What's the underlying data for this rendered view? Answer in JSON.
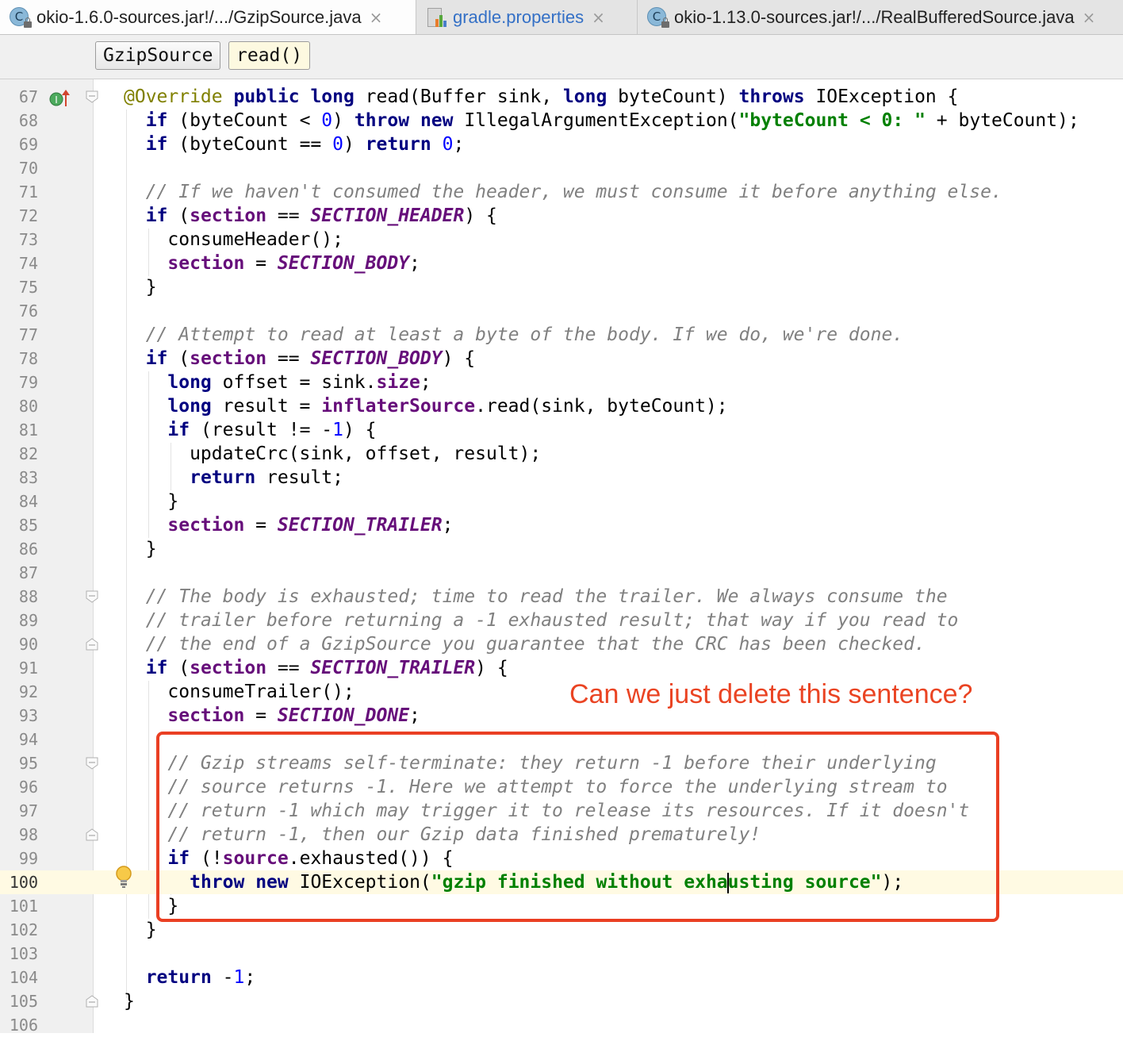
{
  "tabs": [
    {
      "label": "okio-1.6.0-sources.jar!/.../GzipSource.java",
      "icon": "class-icon",
      "icon_glyph": "C",
      "active": true
    },
    {
      "label": "gradle.properties",
      "icon": "gradle-properties-icon",
      "active": false
    },
    {
      "label": "okio-1.13.0-sources.jar!/.../RealBufferedSource.java",
      "icon": "class-icon",
      "icon_glyph": "C",
      "active": false
    }
  ],
  "tab_close_glyph": "×",
  "breadcrumbs": [
    "GzipSource",
    "read()"
  ],
  "editor": {
    "current_line": 100,
    "lines": [
      {
        "n": "67",
        "tokens": [
          [
            "a",
            "@Override"
          ],
          [
            "p",
            " "
          ],
          [
            "k",
            "public"
          ],
          [
            "p",
            " "
          ],
          [
            "k",
            "long"
          ],
          [
            "p",
            " read(Buffer sink, "
          ],
          [
            "k",
            "long"
          ],
          [
            "p",
            " byteCount) "
          ],
          [
            "k",
            "throws"
          ],
          [
            "p",
            " IOException {"
          ]
        ]
      },
      {
        "n": "68",
        "tokens": [
          [
            "p",
            "  "
          ],
          [
            "k",
            "if"
          ],
          [
            "p",
            " (byteCount < "
          ],
          [
            "n",
            "0"
          ],
          [
            "p",
            ") "
          ],
          [
            "k",
            "throw"
          ],
          [
            "p",
            " "
          ],
          [
            "k",
            "new"
          ],
          [
            "p",
            " IllegalArgumentException("
          ],
          [
            "s",
            "\"byteCount < 0: \""
          ],
          [
            "p",
            " + byteCount);"
          ]
        ]
      },
      {
        "n": "69",
        "tokens": [
          [
            "p",
            "  "
          ],
          [
            "k",
            "if"
          ],
          [
            "p",
            " (byteCount == "
          ],
          [
            "n",
            "0"
          ],
          [
            "p",
            ") "
          ],
          [
            "k",
            "return"
          ],
          [
            "p",
            " "
          ],
          [
            "n",
            "0"
          ],
          [
            "p",
            ";"
          ]
        ]
      },
      {
        "n": "70",
        "tokens": []
      },
      {
        "n": "71",
        "tokens": [
          [
            "p",
            "  "
          ],
          [
            "c",
            "// If we haven't consumed the header, we must consume it before anything else."
          ]
        ]
      },
      {
        "n": "72",
        "tokens": [
          [
            "p",
            "  "
          ],
          [
            "k",
            "if"
          ],
          [
            "p",
            " ("
          ],
          [
            "f",
            "section"
          ],
          [
            "p",
            " == "
          ],
          [
            "cst",
            "SECTION_HEADER"
          ],
          [
            "p",
            ") {"
          ]
        ]
      },
      {
        "n": "73",
        "tokens": [
          [
            "p",
            "    consumeHeader();"
          ]
        ]
      },
      {
        "n": "74",
        "tokens": [
          [
            "p",
            "    "
          ],
          [
            "f",
            "section"
          ],
          [
            "p",
            " = "
          ],
          [
            "cst",
            "SECTION_BODY"
          ],
          [
            "p",
            ";"
          ]
        ]
      },
      {
        "n": "75",
        "tokens": [
          [
            "p",
            "  }"
          ]
        ]
      },
      {
        "n": "76",
        "tokens": []
      },
      {
        "n": "77",
        "tokens": [
          [
            "p",
            "  "
          ],
          [
            "c",
            "// Attempt to read at least a byte of the body. If we do, we're done."
          ]
        ]
      },
      {
        "n": "78",
        "tokens": [
          [
            "p",
            "  "
          ],
          [
            "k",
            "if"
          ],
          [
            "p",
            " ("
          ],
          [
            "f",
            "section"
          ],
          [
            "p",
            " == "
          ],
          [
            "cst",
            "SECTION_BODY"
          ],
          [
            "p",
            ") {"
          ]
        ]
      },
      {
        "n": "79",
        "tokens": [
          [
            "p",
            "    "
          ],
          [
            "k",
            "long"
          ],
          [
            "p",
            " offset = sink."
          ],
          [
            "f",
            "size"
          ],
          [
            "p",
            ";"
          ]
        ]
      },
      {
        "n": "80",
        "tokens": [
          [
            "p",
            "    "
          ],
          [
            "k",
            "long"
          ],
          [
            "p",
            " result = "
          ],
          [
            "f",
            "inflaterSource"
          ],
          [
            "p",
            ".read(sink, byteCount);"
          ]
        ]
      },
      {
        "n": "81",
        "tokens": [
          [
            "p",
            "    "
          ],
          [
            "k",
            "if"
          ],
          [
            "p",
            " (result != -"
          ],
          [
            "n",
            "1"
          ],
          [
            "p",
            ") {"
          ]
        ]
      },
      {
        "n": "82",
        "tokens": [
          [
            "p",
            "      updateCrc(sink, offset, result);"
          ]
        ]
      },
      {
        "n": "83",
        "tokens": [
          [
            "p",
            "      "
          ],
          [
            "k",
            "return"
          ],
          [
            "p",
            " result;"
          ]
        ]
      },
      {
        "n": "84",
        "tokens": [
          [
            "p",
            "    }"
          ]
        ]
      },
      {
        "n": "85",
        "tokens": [
          [
            "p",
            "    "
          ],
          [
            "f",
            "section"
          ],
          [
            "p",
            " = "
          ],
          [
            "cst",
            "SECTION_TRAILER"
          ],
          [
            "p",
            ";"
          ]
        ]
      },
      {
        "n": "86",
        "tokens": [
          [
            "p",
            "  }"
          ]
        ]
      },
      {
        "n": "87",
        "tokens": []
      },
      {
        "n": "88",
        "tokens": [
          [
            "p",
            "  "
          ],
          [
            "c",
            "// The body is exhausted; time to read the trailer. We always consume the"
          ]
        ]
      },
      {
        "n": "89",
        "tokens": [
          [
            "p",
            "  "
          ],
          [
            "c",
            "// trailer before returning a -1 exhausted result; that way if you read to"
          ]
        ]
      },
      {
        "n": "90",
        "tokens": [
          [
            "p",
            "  "
          ],
          [
            "c",
            "// the end of a GzipSource you guarantee that the CRC has been checked."
          ]
        ]
      },
      {
        "n": "91",
        "tokens": [
          [
            "p",
            "  "
          ],
          [
            "k",
            "if"
          ],
          [
            "p",
            " ("
          ],
          [
            "f",
            "section"
          ],
          [
            "p",
            " == "
          ],
          [
            "cst",
            "SECTION_TRAILER"
          ],
          [
            "p",
            ") {"
          ]
        ]
      },
      {
        "n": "92",
        "tokens": [
          [
            "p",
            "    consumeTrailer();"
          ]
        ]
      },
      {
        "n": "93",
        "tokens": [
          [
            "p",
            "    "
          ],
          [
            "f",
            "section"
          ],
          [
            "p",
            " = "
          ],
          [
            "cst",
            "SECTION_DONE"
          ],
          [
            "p",
            ";"
          ]
        ]
      },
      {
        "n": "94",
        "tokens": []
      },
      {
        "n": "95",
        "tokens": [
          [
            "p",
            "    "
          ],
          [
            "c",
            "// Gzip streams self-terminate: they return -1 before their underlying"
          ]
        ]
      },
      {
        "n": "96",
        "tokens": [
          [
            "p",
            "    "
          ],
          [
            "c",
            "// source returns -1. Here we attempt to force the underlying stream to"
          ]
        ]
      },
      {
        "n": "97",
        "tokens": [
          [
            "p",
            "    "
          ],
          [
            "c",
            "// return -1 which may trigger it to release its resources. If it doesn't"
          ]
        ]
      },
      {
        "n": "98",
        "tokens": [
          [
            "p",
            "    "
          ],
          [
            "c",
            "// return -1, then our Gzip data finished prematurely!"
          ]
        ]
      },
      {
        "n": "99",
        "tokens": [
          [
            "p",
            "    "
          ],
          [
            "k",
            "if"
          ],
          [
            "p",
            " (!"
          ],
          [
            "f",
            "source"
          ],
          [
            "p",
            ".exhausted()) {"
          ]
        ]
      },
      {
        "n": "100",
        "tokens": [
          [
            "p",
            "      "
          ],
          [
            "k",
            "throw"
          ],
          [
            "p",
            " "
          ],
          [
            "k",
            "new"
          ],
          [
            "p",
            " IOException("
          ],
          [
            "s",
            "\"gzip finished without exha"
          ],
          [
            "caret",
            ""
          ],
          [
            "s",
            "usting source\""
          ],
          [
            "p",
            ");"
          ]
        ]
      },
      {
        "n": "101",
        "tokens": [
          [
            "p",
            "    }"
          ]
        ]
      },
      {
        "n": "102",
        "tokens": [
          [
            "p",
            "  }"
          ]
        ]
      },
      {
        "n": "103",
        "tokens": []
      },
      {
        "n": "104",
        "tokens": [
          [
            "p",
            "  "
          ],
          [
            "k",
            "return"
          ],
          [
            "p",
            " -"
          ],
          [
            "n",
            "1"
          ],
          [
            "p",
            ";"
          ]
        ]
      },
      {
        "n": "105",
        "tokens": [
          [
            "p",
            "}"
          ]
        ]
      },
      {
        "n": "106",
        "tokens": []
      }
    ]
  },
  "gutter_icons": [
    "override-method-icon",
    "fold-icon",
    "intention-bulb-icon"
  ],
  "annotation": {
    "text": "Can we just delete this sentence?",
    "color": "#ea4423",
    "box_color": "#ea3f23"
  }
}
